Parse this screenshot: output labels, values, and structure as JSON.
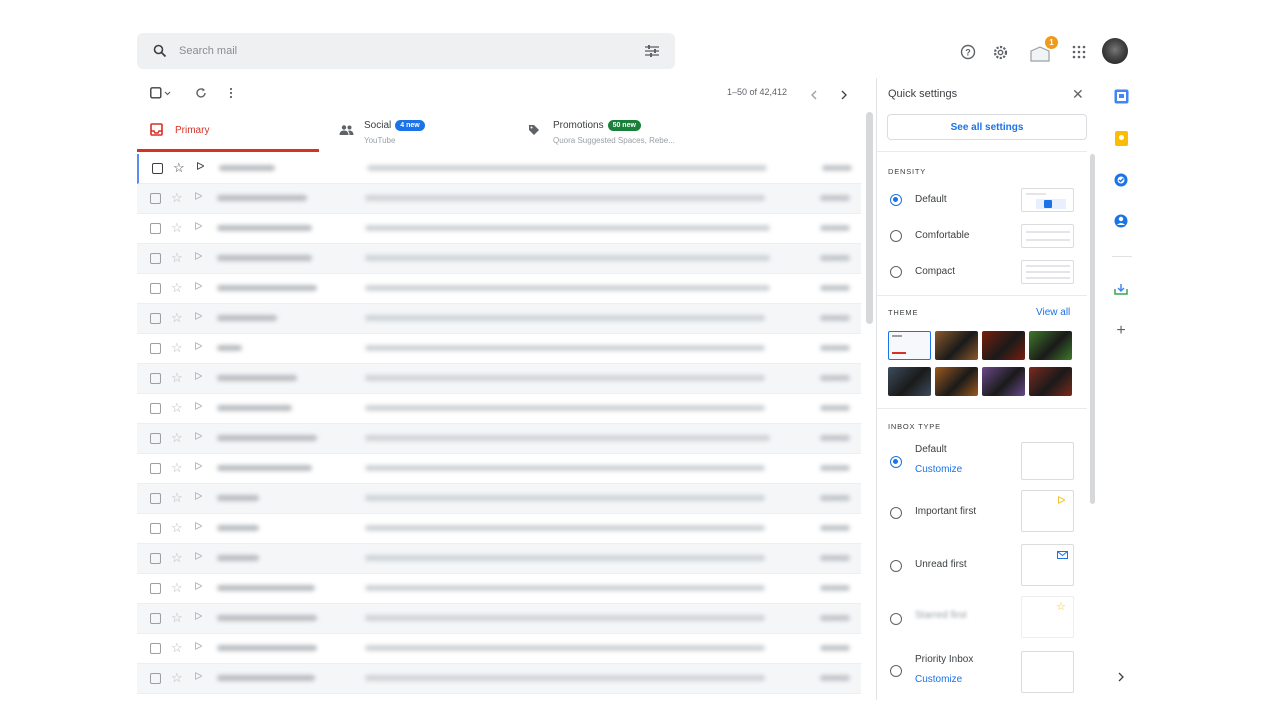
{
  "header": {
    "search_placeholder": "Search mail",
    "badge_count": "1",
    "icons": [
      "search-icon",
      "filter-icon",
      "help-icon",
      "settings-icon",
      "notifications-icon",
      "apps-grid-icon",
      "avatar"
    ]
  },
  "toolbar": {
    "range": "1–50 of 42,412"
  },
  "tabs": [
    {
      "label": "Primary",
      "sub": "",
      "pill": "",
      "active": true,
      "color": "#d93025"
    },
    {
      "label": "Social",
      "sub": "YouTube",
      "pill": "4 new",
      "active": false,
      "color": "#1a73e8"
    },
    {
      "label": "Promotions",
      "sub": "Quora Suggested Spaces, Rebe...",
      "pill": "50 new",
      "active": false,
      "color": "#188038"
    }
  ],
  "emails": [
    {
      "s": 56,
      "j": 400
    },
    {
      "s": 90,
      "j": 400
    },
    {
      "s": 95,
      "j": 405
    },
    {
      "s": 95,
      "j": 405
    },
    {
      "s": 100,
      "j": 405
    },
    {
      "s": 60,
      "j": 400
    },
    {
      "s": 25,
      "j": 400
    },
    {
      "s": 80,
      "j": 400
    },
    {
      "s": 75,
      "j": 400
    },
    {
      "s": 100,
      "j": 405
    },
    {
      "s": 95,
      "j": 400
    },
    {
      "s": 42,
      "j": 400
    },
    {
      "s": 42,
      "j": 400
    },
    {
      "s": 42,
      "j": 400
    },
    {
      "s": 98,
      "j": 400
    },
    {
      "s": 100,
      "j": 400
    },
    {
      "s": 100,
      "j": 400
    },
    {
      "s": 98,
      "j": 400
    }
  ],
  "quick_settings": {
    "title": "Quick settings",
    "see_all": "See all settings",
    "density": {
      "title": "DENSITY",
      "options": [
        "Default",
        "Comfortable",
        "Compact"
      ],
      "selected": "Default"
    },
    "theme": {
      "title": "THEME",
      "view_all": "View all",
      "swatches": [
        "#f6f8fc",
        "#8b5a2b",
        "#7a1e0c",
        "#3f7a2a",
        "#3d4c5c",
        "#9c5a1e",
        "#6a4a8a",
        "#7a2a1e"
      ]
    },
    "inbox_type": {
      "title": "INBOX TYPE",
      "options": [
        "Default",
        "Important first",
        "Unread first",
        "Starred first",
        "Priority Inbox"
      ],
      "customize": "Customize",
      "selected": "Default"
    }
  },
  "colors": {
    "accent": "#1a73e8",
    "primary_red": "#d93025",
    "promo_green": "#188038",
    "badge": "#f09a1b"
  }
}
